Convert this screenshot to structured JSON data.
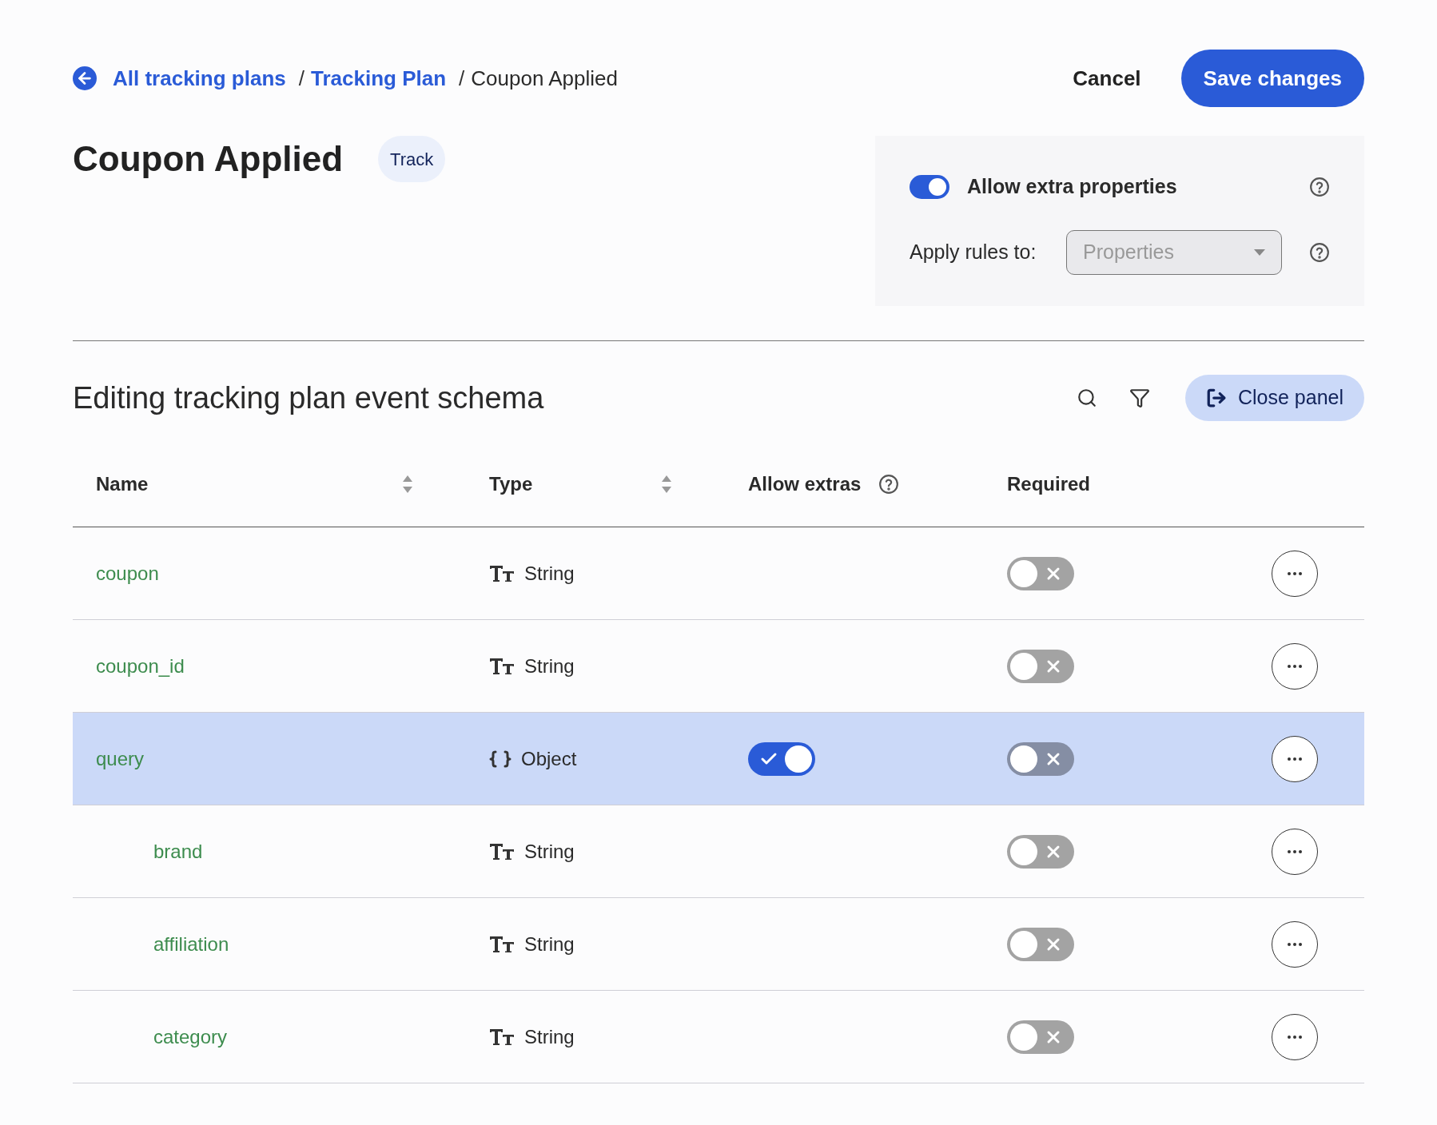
{
  "breadcrumb": {
    "links": [
      "All tracking plans",
      "Tracking Plan"
    ],
    "separators": [
      "/",
      "/"
    ],
    "current": "Coupon Applied"
  },
  "actions": {
    "cancel": "Cancel",
    "save": "Save changes"
  },
  "event": {
    "title": "Coupon Applied",
    "badge": "Track"
  },
  "settings": {
    "allow_extra": {
      "label": "Allow extra properties",
      "on": true
    },
    "apply_rules": {
      "label": "Apply rules to:",
      "value": "Properties"
    }
  },
  "schema": {
    "title": "Editing tracking plan event schema",
    "close": "Close panel"
  },
  "table": {
    "columns": [
      {
        "label": "Name",
        "sortable": true
      },
      {
        "label": "Type",
        "sortable": true
      },
      {
        "label": "Allow extras",
        "help": true
      },
      {
        "label": "Required"
      }
    ],
    "rows": [
      {
        "name": "coupon",
        "type": "String",
        "kind": "string",
        "required": false,
        "selected": false
      },
      {
        "name": "coupon_id",
        "type": "String",
        "kind": "string",
        "required": false,
        "selected": false
      },
      {
        "name": "query",
        "type": "Object",
        "kind": "object",
        "required": false,
        "selected": true,
        "allow_extras": true,
        "children": [
          {
            "name": "brand",
            "type": "String",
            "kind": "string",
            "required": false,
            "selected": false
          },
          {
            "name": "affiliation",
            "type": "String",
            "kind": "string",
            "required": false,
            "selected": false
          },
          {
            "name": "category",
            "type": "String",
            "kind": "string",
            "required": false,
            "selected": false
          }
        ]
      }
    ]
  }
}
